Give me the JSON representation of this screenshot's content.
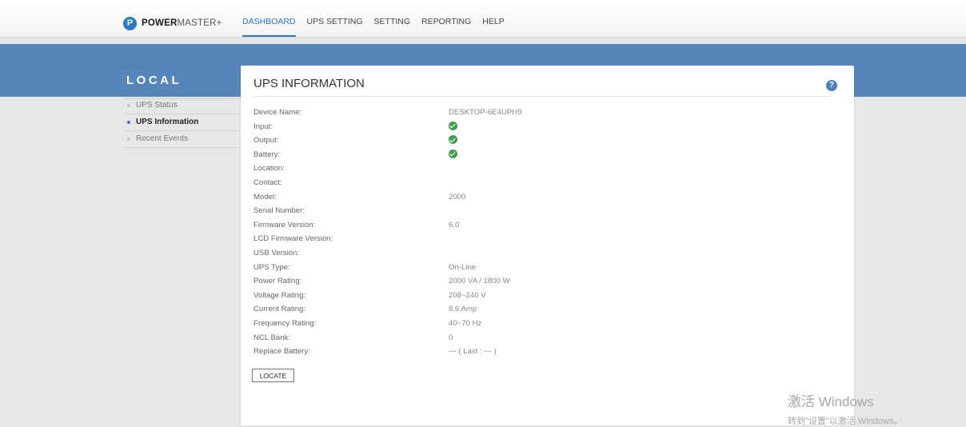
{
  "header": {
    "logo_bold": "POWER",
    "logo_light": "MASTER+",
    "logo_icon": "P",
    "nav": [
      {
        "label": "DASHBOARD",
        "active": true
      },
      {
        "label": "UPS SETTING"
      },
      {
        "label": "SETTING"
      },
      {
        "label": "REPORTING"
      },
      {
        "label": "HELP"
      }
    ]
  },
  "sidebar": {
    "title": "LOCAL",
    "items": [
      {
        "label": "UPS Status"
      },
      {
        "label": "UPS Information",
        "active": true
      },
      {
        "label": "Recent Events"
      }
    ]
  },
  "panel": {
    "title": "UPS INFORMATION",
    "help_icon": "?",
    "rows": [
      {
        "label": "Device Name:",
        "value": "DESKTOP-6E4UPH9"
      },
      {
        "label": "Input:",
        "icon": "check-circle-icon"
      },
      {
        "label": "Output:",
        "icon": "check-circle-icon"
      },
      {
        "label": "Battery:",
        "icon": "check-circle-icon"
      },
      {
        "label": "Location:",
        "value": ""
      },
      {
        "label": "Contact:",
        "value": ""
      },
      {
        "label": "Model:",
        "value": "2000"
      },
      {
        "label": "Serial Number:",
        "value": ""
      },
      {
        "label": "Firmware Version:",
        "value": "6.0"
      },
      {
        "label": "LCD Firmware Version:",
        "value": ""
      },
      {
        "label": "USB Version:",
        "value": ""
      },
      {
        "label": "UPS Type:",
        "value": "On-Line"
      },
      {
        "label": "Power Rating:",
        "value": "2000 VA / 1800 W"
      },
      {
        "label": "Voltage Rating:",
        "value": "208~240 V"
      },
      {
        "label": "Current Rating:",
        "value": "8.6 Amp"
      },
      {
        "label": "Frequency Rating:",
        "value": "40~70 Hz"
      },
      {
        "label": "NCL Bank:",
        "value": "0"
      },
      {
        "label": "Replace Battery:",
        "value": "--- ( Last : --- )"
      }
    ],
    "locate_label": "LOCATE"
  },
  "watermark": {
    "line1": "激活 Windows",
    "line2": "转到\"设置\"以激活 Windows。"
  },
  "colors": {
    "accent": "#2b73c4",
    "band": "#5585ba",
    "status_ok": "#3da04f"
  }
}
